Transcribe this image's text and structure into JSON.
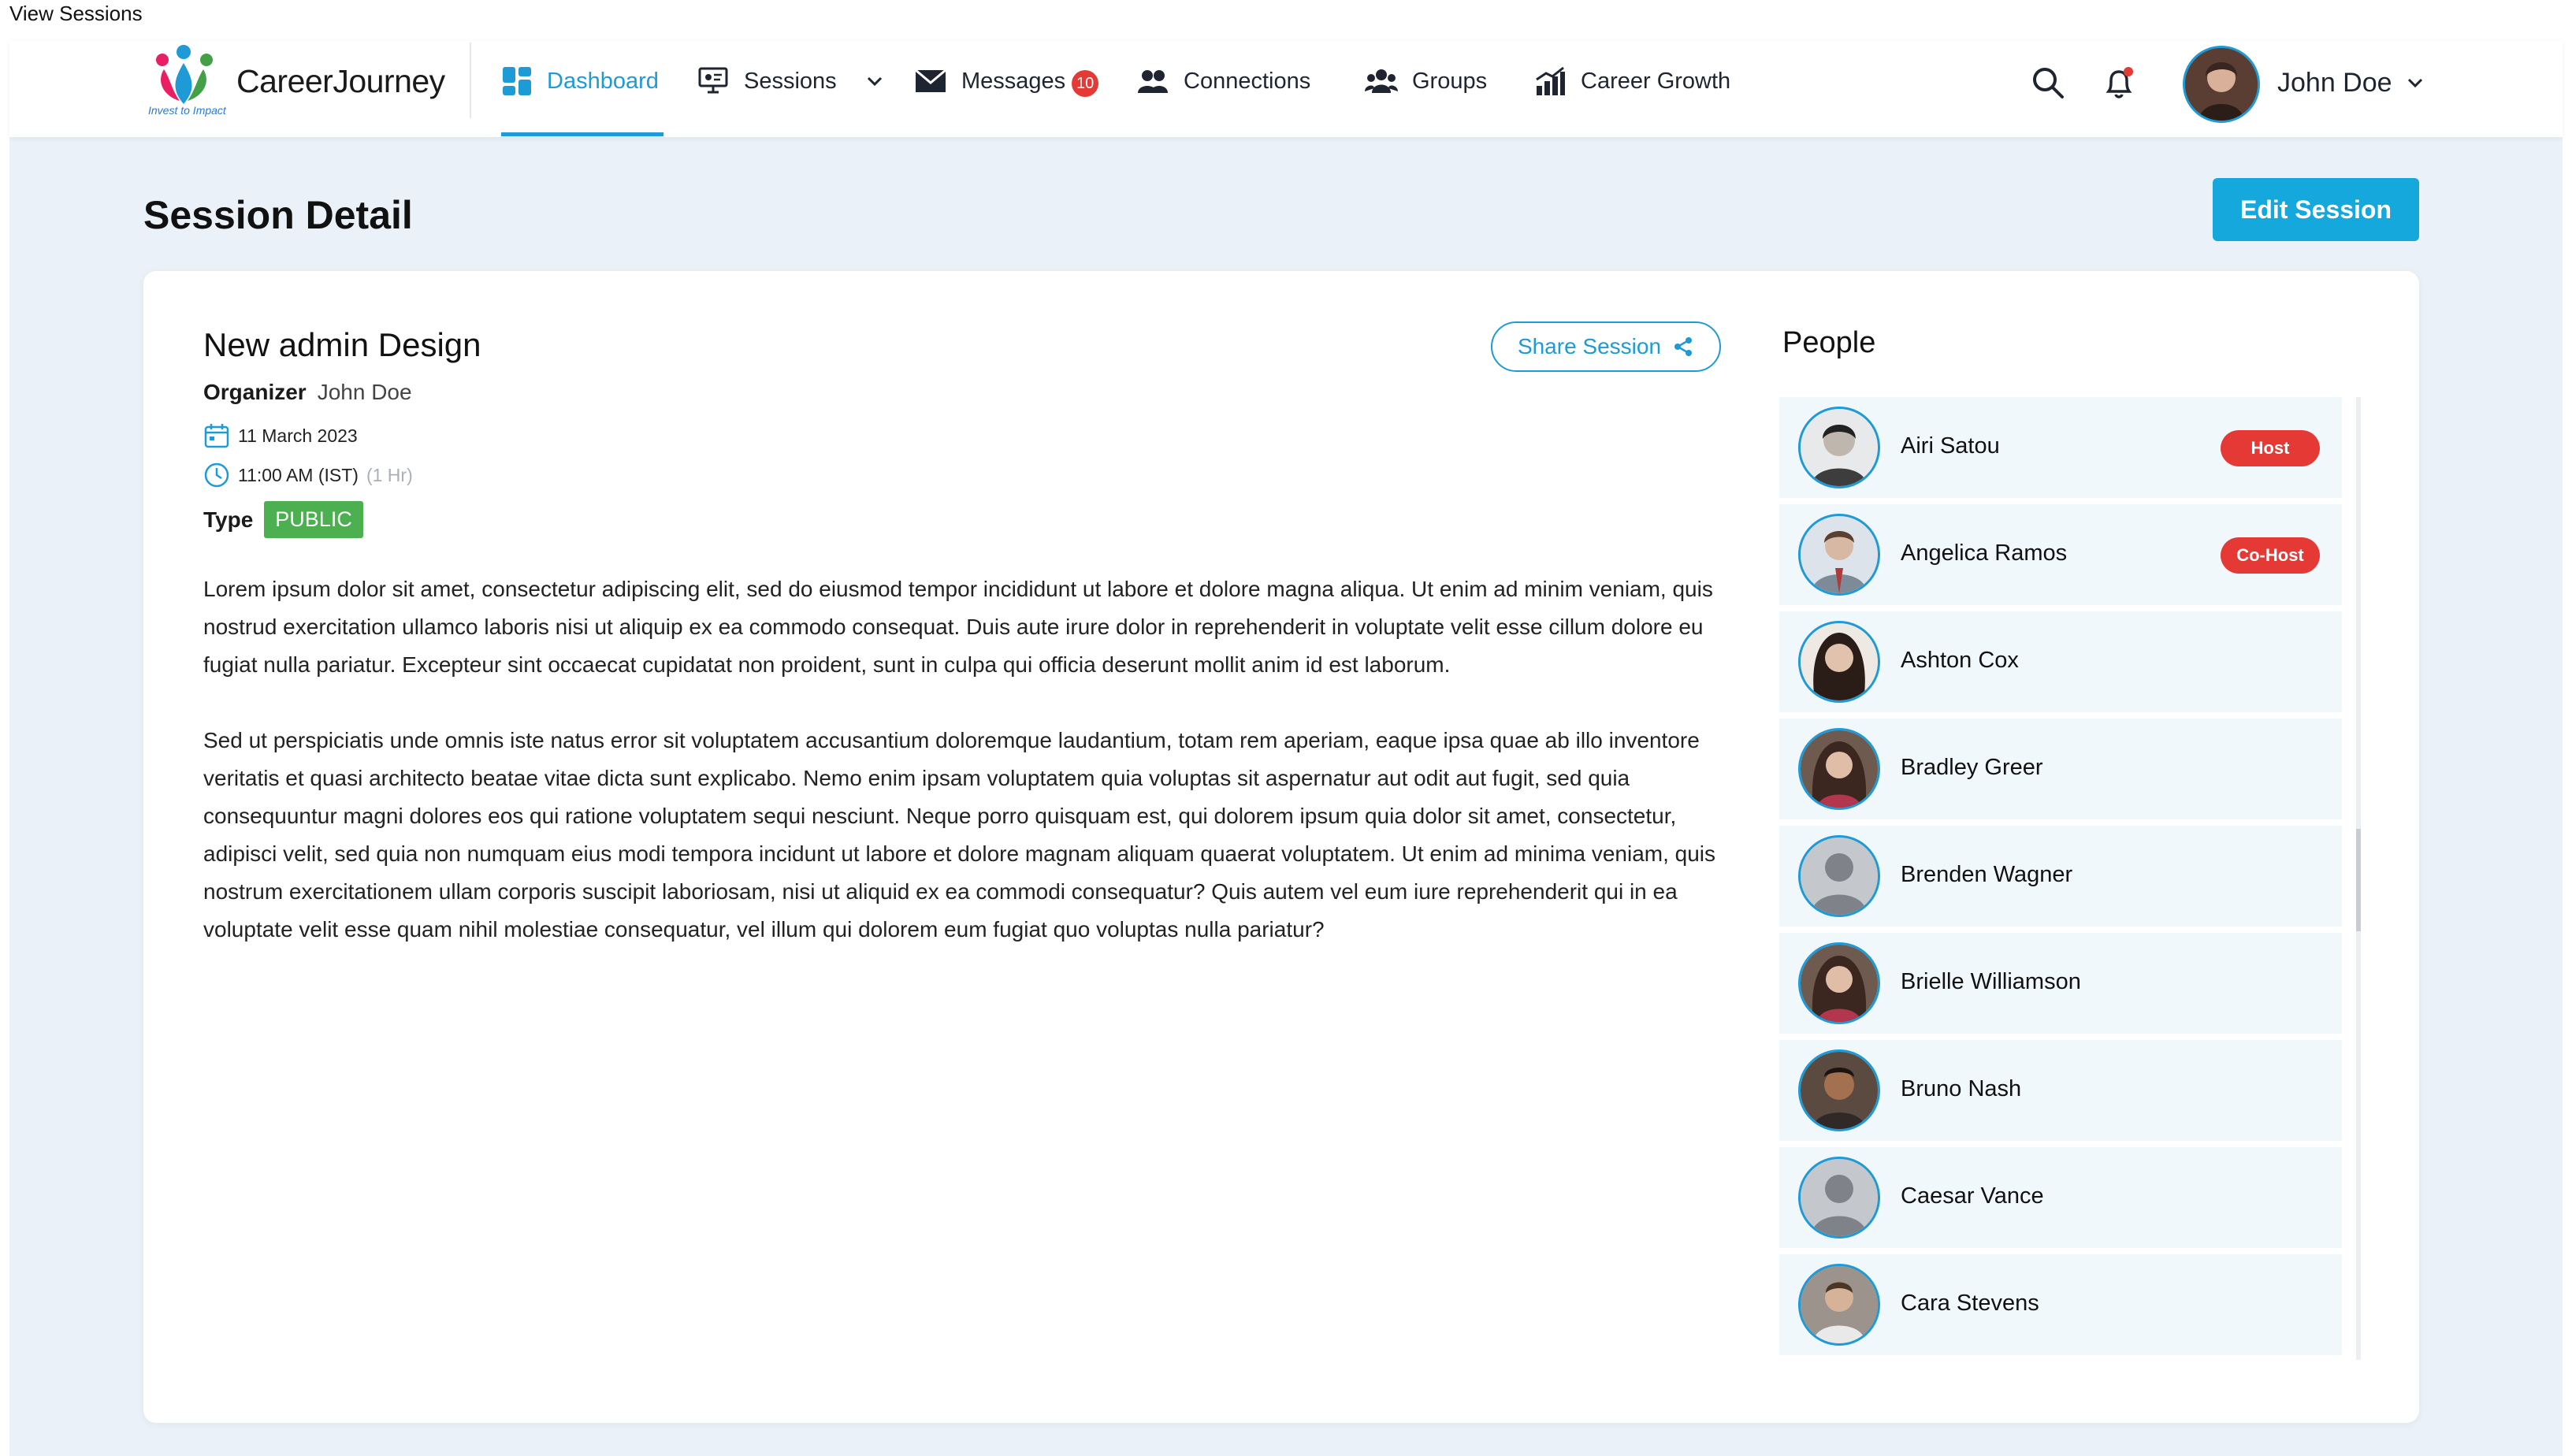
{
  "window_label": "View Sessions",
  "brand": {
    "name": "CareerJourney",
    "tagline": "Invest to Impact"
  },
  "nav": {
    "items": [
      {
        "label": "Dashboard",
        "icon": "dashboard-icon"
      },
      {
        "label": "Sessions",
        "icon": "sessions-icon"
      },
      {
        "label": "Messages",
        "icon": "envelope-icon",
        "badge": "10"
      },
      {
        "label": "Connections",
        "icon": "connections-icon"
      },
      {
        "label": "Groups",
        "icon": "groups-icon"
      },
      {
        "label": "Career Growth",
        "icon": "growth-chart-icon"
      }
    ],
    "active": "Dashboard"
  },
  "user": {
    "name": "John Doe"
  },
  "page": {
    "title": "Session Detail",
    "edit_label": "Edit Session"
  },
  "session": {
    "title": "New admin Design",
    "share_label": "Share Session",
    "organizer_label": "Organizer",
    "organizer": "John Doe",
    "date": "11 March 2023",
    "time": "11:00 AM (IST)",
    "duration": "(1 Hr)",
    "type_label": "Type",
    "type": "PUBLIC",
    "paragraphs": [
      "Lorem ipsum dolor sit amet, consectetur adipiscing elit, sed do eiusmod tempor incididunt ut labore et dolore magna aliqua. Ut enim ad minim veniam, quis nostrud exercitation ullamco laboris nisi ut aliquip ex ea commodo consequat. Duis aute irure dolor in reprehenderit in voluptate velit esse cillum dolore eu fugiat nulla pariatur. Excepteur sint occaecat cupidatat non proident, sunt in culpa qui officia deserunt mollit anim id est laborum.",
      "Sed ut perspiciatis unde omnis iste natus error sit voluptatem accusantium doloremque laudantium, totam rem aperiam, eaque ipsa quae ab illo inventore veritatis et quasi architecto beatae vitae dicta sunt explicabo. Nemo enim ipsam voluptatem quia voluptas sit aspernatur aut odit aut fugit, sed quia consequuntur magni dolores eos qui ratione voluptatem sequi nesciunt. Neque porro quisquam est, qui dolorem ipsum quia dolor sit amet, consectetur, adipisci velit, sed quia non numquam eius modi tempora incidunt ut labore et dolore magnam aliquam quaerat voluptatem. Ut enim ad minima veniam, quis nostrum exercitationem ullam corporis suscipit laboriosam, nisi ut aliquid ex ea commodi consequatur? Quis autem vel eum iure reprehenderit qui in ea voluptate velit esse quam nihil molestiae consequatur, vel illum qui dolorem eum fugiat quo voluptas nulla pariatur?"
    ]
  },
  "people": {
    "title": "People",
    "list": [
      {
        "name": "Airi Satou",
        "role": "Host",
        "avatar_color": "#7a7f86"
      },
      {
        "name": "Angelica Ramos",
        "role": "Co-Host",
        "avatar_color": "#9aa4ae"
      },
      {
        "name": "Ashton Cox",
        "role": "",
        "avatar_color": "#3b2a26"
      },
      {
        "name": "Bradley Greer",
        "role": "",
        "avatar_color": "#5a3b33"
      },
      {
        "name": "Brenden Wagner",
        "role": "",
        "avatar_color": "#b9bcc1"
      },
      {
        "name": "Brielle Williamson",
        "role": "",
        "avatar_color": "#5a3b33"
      },
      {
        "name": "Bruno Nash",
        "role": "",
        "avatar_color": "#4a3326"
      },
      {
        "name": "Caesar Vance",
        "role": "",
        "avatar_color": "#b9bcc1"
      },
      {
        "name": "Cara Stevens",
        "role": "",
        "avatar_color": "#8b8078"
      }
    ]
  },
  "colors": {
    "accent": "#1e9ad6",
    "badge_red": "#e53935",
    "public_green": "#4caf50",
    "page_bg": "#eaf1f8"
  }
}
